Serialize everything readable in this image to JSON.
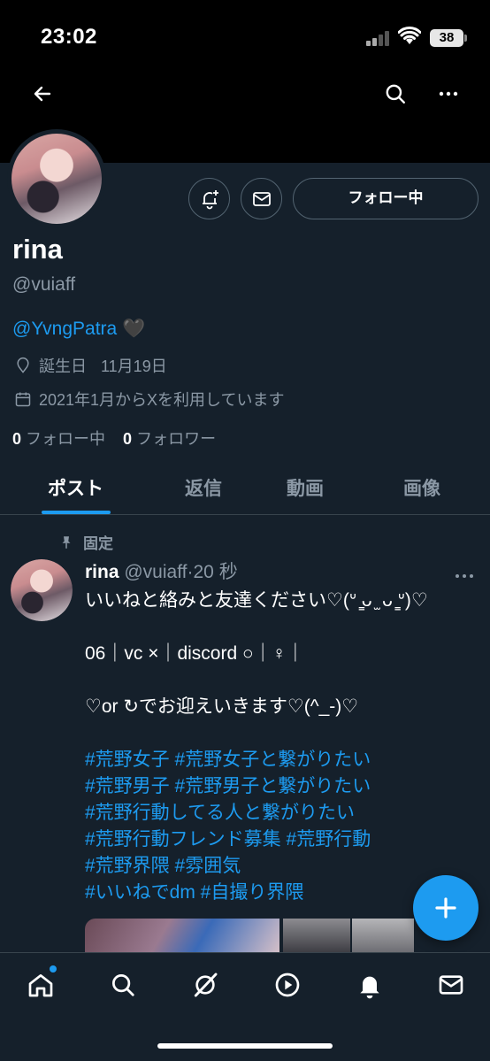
{
  "status_bar": {
    "time": "23:02",
    "battery": "38"
  },
  "profile": {
    "name": "rina",
    "handle": "@vuiaff",
    "bio_mention": "@YvngPatra",
    "bio_emoji": "🖤",
    "birthday_label": "誕生日",
    "birthday": "11月19日",
    "joined": "2021年1月からXを利用しています",
    "following_count": "0",
    "following_label": "フォロー中",
    "followers_count": "0",
    "followers_label": "フォロワー",
    "follow_button": "フォロー中"
  },
  "tabs": [
    "ポスト",
    "返信",
    "動画",
    "画像"
  ],
  "post": {
    "pinned_label": "固定",
    "author": "rina",
    "handle": "@vuiaff",
    "sep": "·",
    "time": "20 秒",
    "lines": [
      "いいねと絡みと友達ください♡(ᐡ ̳ᴗ ̫ ᴗ ̳ᐡ)♡",
      "06｜vc ×｜discord ○｜♀｜",
      "♡or ↻でお迎えいきます♡(^_-)♡"
    ],
    "hashtags": [
      "#荒野女子 #荒野女子と繋がりたい",
      "#荒野男子 #荒野男子と繋がりたい",
      "#荒野行動してる人と繋がりたい",
      "#荒野行動フレンド募集 #荒野行動",
      "#荒野界隈 #雰囲気",
      "#いいねでdm  #自撮り界隈"
    ]
  },
  "colors": {
    "background": "#15202b",
    "accent": "#1d9bf0",
    "secondary_text": "#8b98a5",
    "border": "#38444d"
  },
  "icons": [
    "back-arrow-icon",
    "search-icon",
    "more-icon",
    "notification-bell-plus-icon",
    "mail-icon",
    "pin-icon",
    "location-icon",
    "calendar-icon",
    "plus-icon",
    "home-icon",
    "grok-icon",
    "play-icon",
    "bell-icon"
  ]
}
